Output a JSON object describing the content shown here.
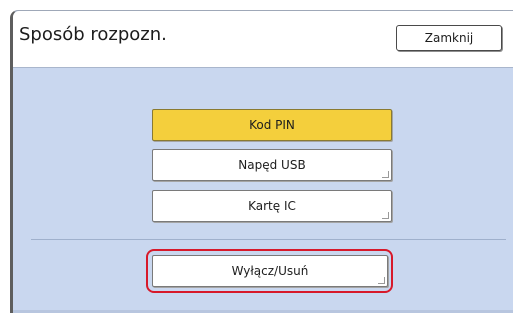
{
  "header": {
    "title": "Sposób rozpozn.",
    "close_label": "Zamknij"
  },
  "options": [
    {
      "label": "Kod PIN",
      "selected": true
    },
    {
      "label": "Napęd USB",
      "selected": false
    },
    {
      "label": "Kartę IC",
      "selected": false
    }
  ],
  "disable_button": {
    "label": "Wyłącz/Usuń"
  },
  "colors": {
    "panel_bg": "#c9d7ef",
    "selected_bg": "#f4cf3c",
    "highlight_border": "#d7192a"
  }
}
